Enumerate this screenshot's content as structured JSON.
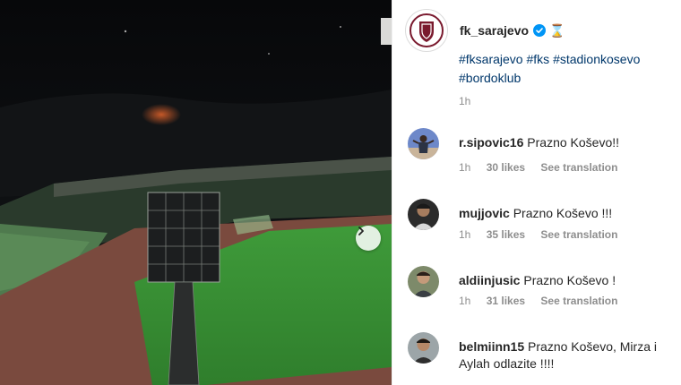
{
  "post": {
    "username": "fk_sarajevo",
    "verified_icon": "verified-badge-icon",
    "status_emoji": "⌛",
    "caption_tags": [
      "#fksarajevo",
      "#fks",
      "#stadionkosevo",
      "#bordoklub"
    ],
    "time": "1h"
  },
  "comments": [
    {
      "user": "r.sipovic16",
      "text": "Prazno Koševo!!",
      "time": "1h",
      "likes": "30 likes",
      "translate": "See translation"
    },
    {
      "user": "mujjovic",
      "text": "Prazno Koševo !!!",
      "time": "1h",
      "likes": "35 likes",
      "translate": "See translation"
    },
    {
      "user": "aldiinjusic",
      "text": "Prazno Koševo !",
      "time": "1h",
      "likes": "31 likes",
      "translate": "See translation"
    },
    {
      "user": "belmiinn15",
      "text": "Prazno Koševo, Mirza i Aylah odlazite !!!!"
    }
  ],
  "colors": {
    "link": "#00376b",
    "verified": "#0095f6",
    "muted": "#8e8e8e",
    "club": "#7a1a2e"
  },
  "icons": {
    "next": "chevron-right-icon"
  }
}
